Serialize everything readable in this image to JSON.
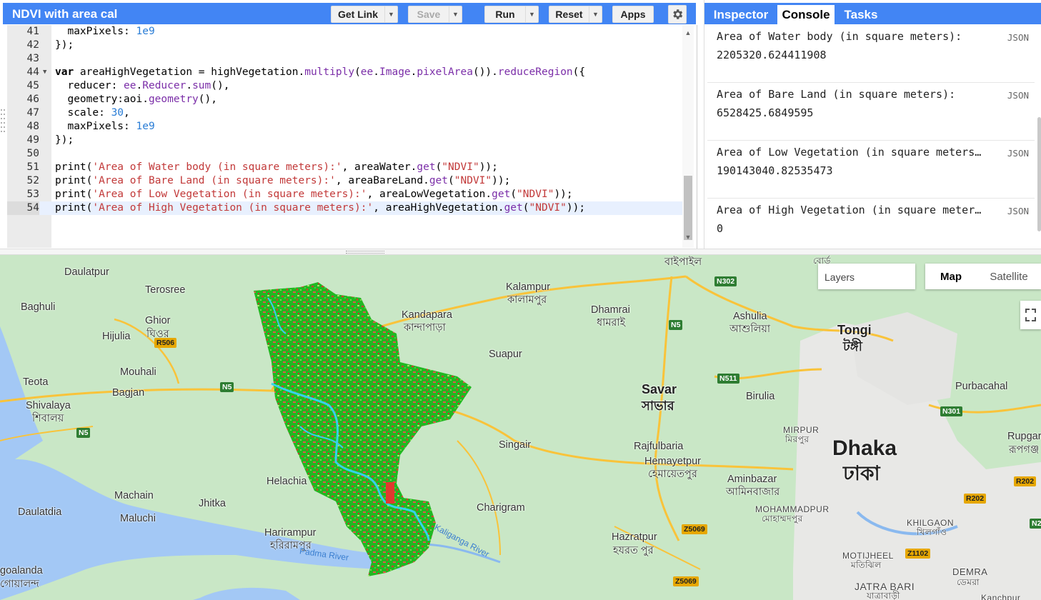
{
  "editor": {
    "script_title": "NDVI with area cal",
    "buttons": {
      "get_link": "Get Link",
      "save": "Save",
      "run": "Run",
      "reset": "Reset",
      "apps": "Apps"
    },
    "active_line": 54,
    "lines": [
      {
        "n": "41",
        "t": "  maxPixels: 1e9"
      },
      {
        "n": "42",
        "t": "});"
      },
      {
        "n": "43",
        "t": ""
      },
      {
        "n": "44",
        "t": "var areaHighVegetation = highVegetation.multiply(ee.Image.pixelArea()).reduceRegion({"
      },
      {
        "n": "45",
        "t": "  reducer: ee.Reducer.sum(),"
      },
      {
        "n": "46",
        "t": "  geometry:aoi.geometry(),"
      },
      {
        "n": "47",
        "t": "  scale: 30,"
      },
      {
        "n": "48",
        "t": "  maxPixels: 1e9"
      },
      {
        "n": "49",
        "t": "});"
      },
      {
        "n": "50",
        "t": ""
      },
      {
        "n": "51",
        "t": "print('Area of Water body (in square meters):', areaWater.get(\"NDVI\"));"
      },
      {
        "n": "52",
        "t": "print('Area of Bare Land (in square meters):', areaBareLand.get(\"NDVI\"));"
      },
      {
        "n": "53",
        "t": "print('Area of Low Vegetation (in square meters):', areaLowVegetation.get(\"NDVI\"));"
      },
      {
        "n": "54",
        "t": "print('Area of High Vegetation (in square meters):', areaHighVegetation.get(\"NDVI\"));"
      }
    ]
  },
  "right_panel": {
    "tabs": [
      "Inspector",
      "Console",
      "Tasks"
    ],
    "active_tab": "Console",
    "console": [
      {
        "label": "Area of Water body (in square meters):",
        "value": "2205320.624411908",
        "json": "JSON"
      },
      {
        "label": "Area of Bare Land (in square meters):",
        "value": "6528425.6849595",
        "json": "JSON"
      },
      {
        "label": "Area of Low Vegetation (in square meters…",
        "value": "190143040.82535473",
        "json": "JSON"
      },
      {
        "label": "Area of High Vegetation (in square meter…",
        "value": "0",
        "json": "JSON"
      }
    ]
  },
  "map": {
    "layers_label": "Layers",
    "map_type": {
      "map": "Map",
      "satellite": "Satellite"
    },
    "places": [
      {
        "t": "Daulatpur"
      },
      {
        "t": "Terosree"
      },
      {
        "t": "Baghuli"
      },
      {
        "t": "Ghior"
      },
      {
        "t": "ঘিওর"
      },
      {
        "t": "Hijulia"
      },
      {
        "t": "Mouhali"
      },
      {
        "t": "Teota"
      },
      {
        "t": "Bagjan"
      },
      {
        "t": "Shivalaya"
      },
      {
        "t": "শিবালয়"
      },
      {
        "t": "Machain"
      },
      {
        "t": "Jhitka"
      },
      {
        "t": "Daulatdia"
      },
      {
        "t": "Maluchi"
      },
      {
        "t": "Harirampur"
      },
      {
        "t": "হরিরামপুর"
      },
      {
        "t": "Helachia"
      },
      {
        "t": "Kalampur"
      },
      {
        "t": "কালামপুর"
      },
      {
        "t": "Kandapara"
      },
      {
        "t": "কান্দাপাড়া"
      },
      {
        "t": "Dhamrai"
      },
      {
        "t": "ধামরাই"
      },
      {
        "t": "Suapur"
      },
      {
        "t": "Singair"
      },
      {
        "t": "Charigram"
      },
      {
        "t": "Savar"
      },
      {
        "t": "সাভার"
      },
      {
        "t": "Rajfulbaria"
      },
      {
        "t": "Hemayetpur"
      },
      {
        "t": "হেমায়েতপুর"
      },
      {
        "t": "Aminbazar"
      },
      {
        "t": "আমিনবাজার"
      },
      {
        "t": "Hazratpur"
      },
      {
        "t": "হযরত পুর"
      },
      {
        "t": "বাইপাইল"
      },
      {
        "t": "Ashulia"
      },
      {
        "t": "আশুলিয়া"
      },
      {
        "t": "Birulia"
      },
      {
        "t": "Tongi"
      },
      {
        "t": "টঙ্গী"
      },
      {
        "t": "Purbacahal"
      },
      {
        "t": "Dhaka"
      },
      {
        "t": "ঢাকা"
      },
      {
        "t": "MIRPUR"
      },
      {
        "t": "মিরপুর"
      },
      {
        "t": "MOHAMMADPUR"
      },
      {
        "t": "মোহাম্মদপুর"
      },
      {
        "t": "KHILGAON"
      },
      {
        "t": "খিলগাঁও"
      },
      {
        "t": "MOTIJHEEL"
      },
      {
        "t": "মতিঝিল"
      },
      {
        "t": "DEMRA"
      },
      {
        "t": "ডেমরা"
      },
      {
        "t": "JATRA BARI"
      },
      {
        "t": "যাত্রাবাড়ী"
      },
      {
        "t": "Rupgar"
      },
      {
        "t": "রূপগঞ্জ"
      },
      {
        "t": "Padma River"
      },
      {
        "t": "Kaliganga River"
      },
      {
        "t": "goalanda"
      },
      {
        "t": "গোয়ালন্দ"
      },
      {
        "t": "বোর্ড"
      },
      {
        "t": "Kanchpur"
      }
    ],
    "shields": [
      "N302",
      "N5",
      "N511",
      "N301",
      "R506",
      "N5",
      "N5",
      "Z5069",
      "Z5069",
      "Z1102",
      "R202",
      "R202",
      "N2"
    ]
  },
  "colors": {
    "brand_blue": "#4285f4",
    "ndvi_high": "#1fb81f",
    "ndvi_bare": "#e03a2f",
    "ndvi_water": "#35d3e8"
  }
}
